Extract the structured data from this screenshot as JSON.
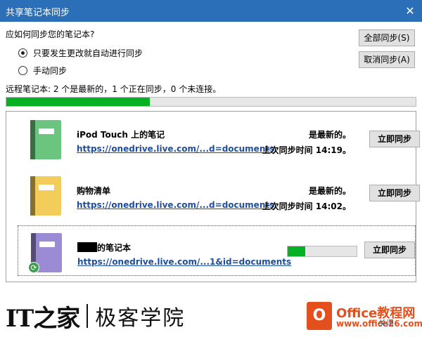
{
  "window": {
    "title": "共享笔记本同步",
    "close_glyph": "✕"
  },
  "question": "应如何同步您的笔记本?",
  "options": [
    {
      "label": "只要发生更改就自动进行同步",
      "checked": true
    },
    {
      "label": "手动同步",
      "checked": false
    }
  ],
  "buttons": {
    "sync_all": "全部同步(S)",
    "cancel_sync": "取消同步(A)"
  },
  "summary": "远程笔记本: 2 个是最新的，1 个正在同步，0 个未连接。",
  "overall_progress": 0.35,
  "notebooks": [
    {
      "name": "iPod Touch 上的笔记",
      "link": "https://onedrive.live.com/...d=documents",
      "status": "是最新的。",
      "last_sync": "上次同步时间 14:19。",
      "sync_button": "立即同步",
      "color": "#6cc57f"
    },
    {
      "name": "购物清单",
      "link": "https://onedrive.live.com/...d=documents",
      "status": "是最新的。",
      "last_sync": "上次同步时间 14:02。",
      "sync_button": "立即同步",
      "color": "#f2cd5c"
    },
    {
      "name_suffix": "的笔记本",
      "link": "https://onedrive.live.com/...1&id=documents",
      "progress": 0.25,
      "sync_button": "立即同步",
      "color": "#9b8bd4",
      "badge_glyph": "⟳"
    }
  ],
  "footer": {
    "it_logo": "IT之家",
    "brand": "极客学院",
    "office_glyph": "O",
    "office_brand": "Office教程网",
    "office_url": "www.office26.com",
    "close_label": "关闭"
  }
}
